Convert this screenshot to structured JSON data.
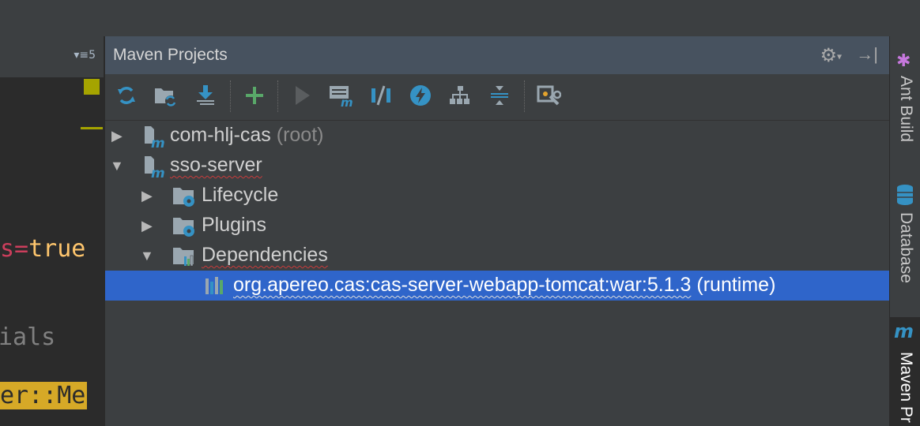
{
  "editor": {
    "tab_count": "5",
    "lines": [
      {
        "text": "s=true",
        "color": "#ffc66d"
      },
      {
        "text": "ials",
        "color": "#808080"
      },
      {
        "text": "er::Me",
        "color": "#2b2b2b"
      }
    ]
  },
  "panel": {
    "title": "Maven Projects",
    "toolbar": [
      "reimport-icon",
      "generate-sources-icon",
      "download-icon",
      "add-icon",
      "run-icon",
      "execute-goal-icon",
      "toggle-offline-icon",
      "skip-tests-icon",
      "show-dependencies-icon",
      "collapse-all-icon",
      "settings-icon"
    ]
  },
  "tree": {
    "root": {
      "name": "com-hlj-cas",
      "suffix": "(root)"
    },
    "server": {
      "name": "sso-server"
    },
    "lifecycle": {
      "name": "Lifecycle"
    },
    "plugins": {
      "name": "Plugins"
    },
    "dependencies": {
      "name": "Dependencies"
    },
    "dependency": {
      "name": "org.apereo.cas:cas-server-webapp-tomcat:war:5.1.3",
      "scope": "(runtime)"
    }
  },
  "strip": {
    "ant": "Ant Build",
    "database": "Database",
    "maven": "Maven Pr"
  },
  "colors": {
    "selection": "#2f65ca",
    "header": "#47525f",
    "accent_blue": "#3592c4",
    "add_green": "#59a869"
  }
}
